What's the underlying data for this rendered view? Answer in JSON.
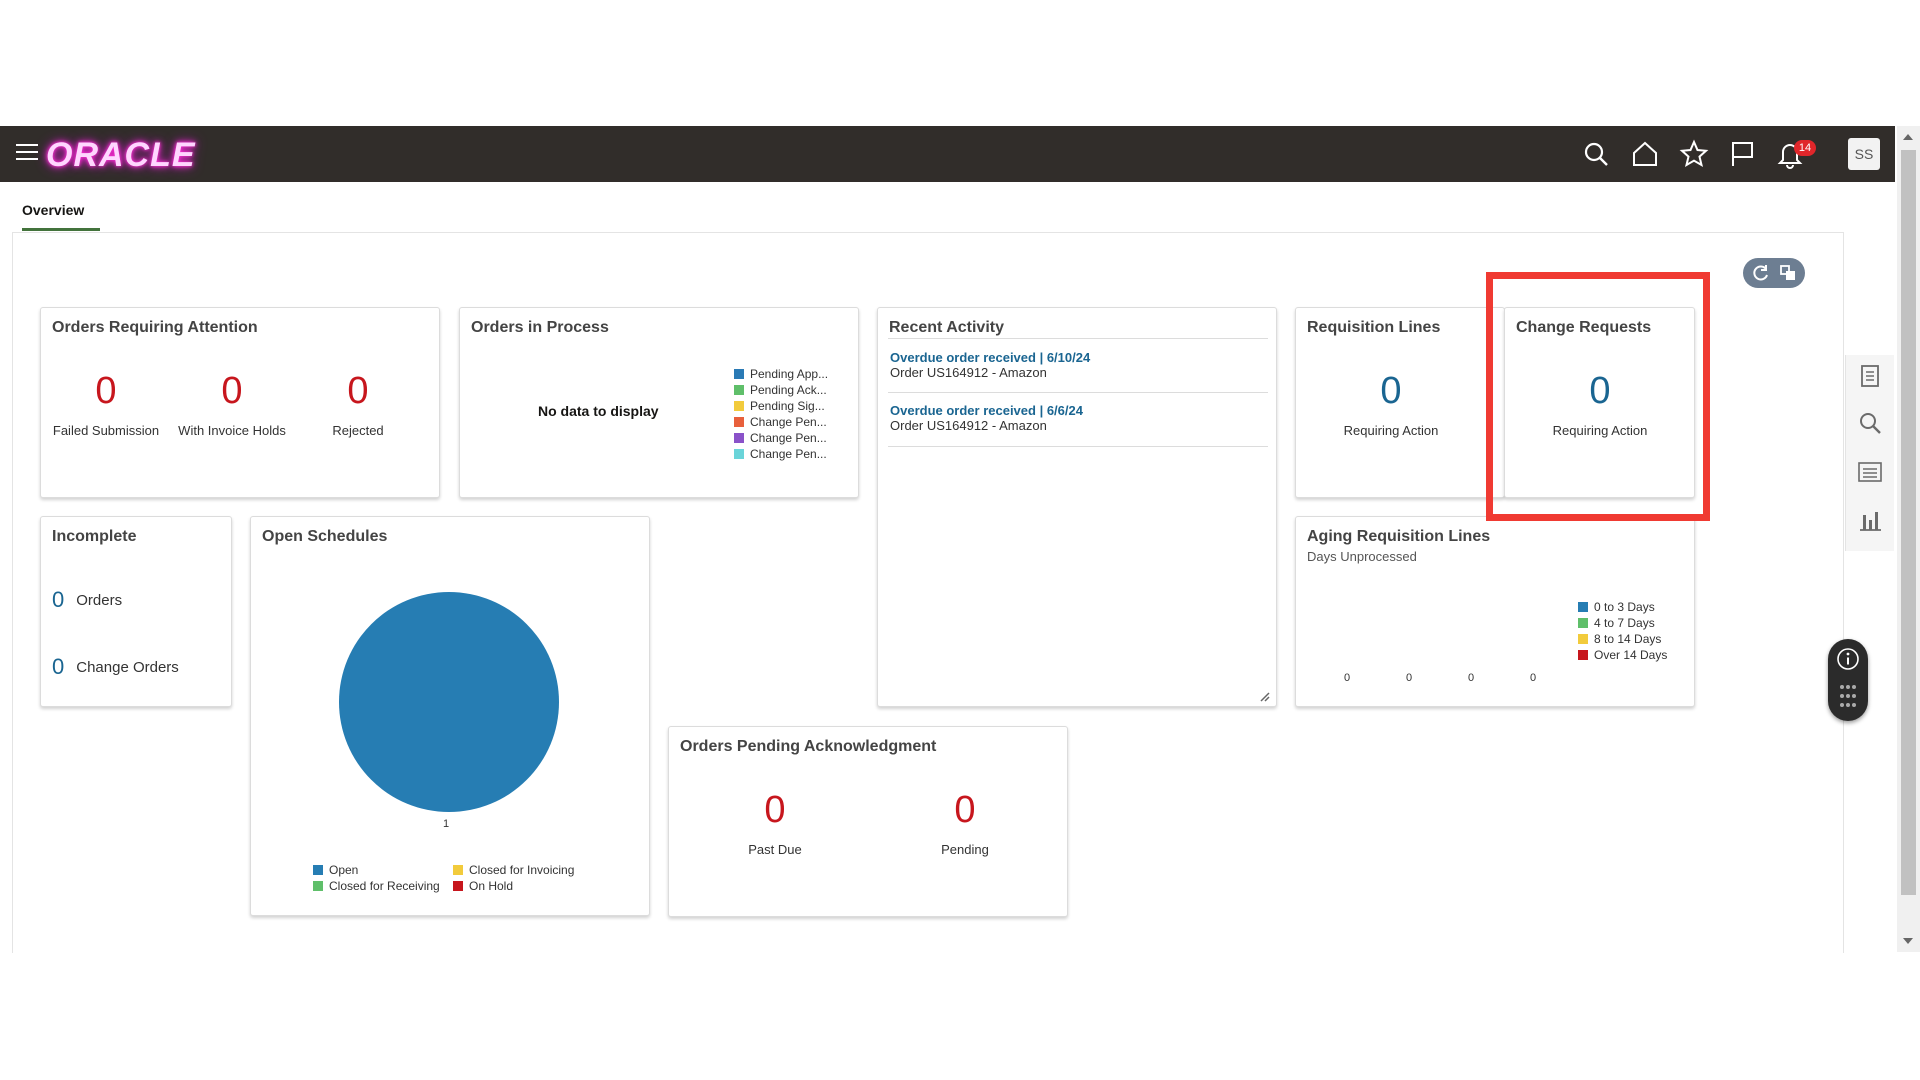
{
  "header": {
    "logo_text": "ORACLE",
    "notifications_count": "14",
    "user_initials": "SS"
  },
  "tabs": {
    "overview": "Overview"
  },
  "cards": {
    "orders_requiring_attention": {
      "title": "Orders Requiring Attention",
      "metrics": [
        {
          "value": "0",
          "label": "Failed Submission"
        },
        {
          "value": "0",
          "label": "With Invoice Holds"
        },
        {
          "value": "0",
          "label": "Rejected"
        }
      ]
    },
    "orders_in_process": {
      "title": "Orders in Process",
      "empty_text": "No data to display",
      "legend": [
        {
          "label": "Pending App...",
          "color": "#2a7ab5"
        },
        {
          "label": "Pending Ack...",
          "color": "#5fbf6a"
        },
        {
          "label": "Pending Sig...",
          "color": "#f2cb3c"
        },
        {
          "label": "Change Pen...",
          "color": "#e8603c"
        },
        {
          "label": "Change Pen...",
          "color": "#8a52c9"
        },
        {
          "label": "Change Pen...",
          "color": "#6ad4d9"
        }
      ]
    },
    "recent_activity": {
      "title": "Recent Activity",
      "items": [
        {
          "link": "Overdue order received | 6/10/24",
          "text": "Order US164912 - Amazon"
        },
        {
          "link": "Overdue order received | 6/6/24",
          "text": "Order US164912 - Amazon"
        }
      ]
    },
    "requisition_lines": {
      "title": "Requisition Lines",
      "value": "0",
      "label": "Requiring Action"
    },
    "change_requests": {
      "title": "Change Requests",
      "value": "0",
      "label": "Requiring Action"
    },
    "incomplete": {
      "title": "Incomplete",
      "rows": [
        {
          "value": "0",
          "label": "Orders"
        },
        {
          "value": "0",
          "label": "Change Orders"
        }
      ]
    },
    "open_schedules": {
      "title": "Open Schedules",
      "pie_value_label": "1",
      "pie_color": "#267db3",
      "legend": [
        {
          "label": "Open",
          "color": "#267db3"
        },
        {
          "label": "Closed for Invoicing",
          "color": "#f2cb3c"
        },
        {
          "label": "Closed for Receiving",
          "color": "#5fbf6a"
        },
        {
          "label": "On Hold",
          "color": "#c7161d"
        }
      ]
    },
    "aging_requisition_lines": {
      "title": "Aging Requisition Lines",
      "subtitle": "Days Unprocessed",
      "values": [
        "0",
        "0",
        "0",
        "0"
      ],
      "legend": [
        {
          "label": "0 to 3 Days",
          "color": "#267db3"
        },
        {
          "label": "4 to 7 Days",
          "color": "#5fbf6a"
        },
        {
          "label": "8 to 14 Days",
          "color": "#f2cb3c"
        },
        {
          "label": "Over 14 Days",
          "color": "#c7161d"
        }
      ]
    },
    "orders_pending_ack": {
      "title": "Orders Pending Acknowledgment",
      "metrics": [
        {
          "value": "0",
          "label": "Past Due"
        },
        {
          "value": "0",
          "label": "Pending"
        }
      ]
    }
  },
  "colors": {
    "header_bg": "#312d2a",
    "accent_red": "#c7161d",
    "accent_blue": "#1a6591",
    "highlight": "#f03a32"
  }
}
